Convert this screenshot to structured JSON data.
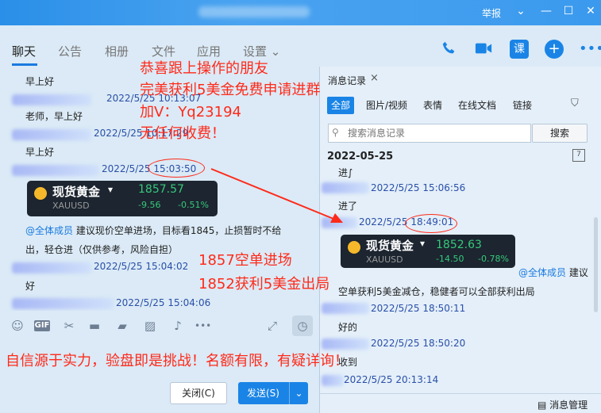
{
  "titlebar": {
    "report": "举报",
    "controls": [
      "chevron-down",
      "minimize",
      "maximize",
      "close"
    ]
  },
  "nav_tabs": [
    {
      "label": "聊天",
      "active": true
    },
    {
      "label": "公告"
    },
    {
      "label": "相册"
    },
    {
      "label": "文件"
    },
    {
      "label": "应用"
    },
    {
      "label": "设置 ⌄"
    }
  ],
  "header_icons": [
    "phone-icon",
    "video-icon",
    "class-icon",
    "plus-icon",
    "more-icon"
  ],
  "header_icon_class": "课",
  "chat": {
    "messages": [
      {
        "text": "早上好"
      },
      {
        "time": "2022/5/25 10:13:07"
      },
      {
        "text": "老师，早上好"
      },
      {
        "time": "2022/5/25 10:17:29"
      },
      {
        "text": "早上好"
      },
      {
        "time": "2022/5/25 15:03:50"
      },
      {
        "mention": "@全体成员",
        "text": "建议现价空单进场，目标看1845，止损暂时不给"
      },
      {
        "text": "出，轻仓进（仅供参考，风险自担）"
      },
      {
        "time": "2022/5/25 15:04:02"
      },
      {
        "text": "好"
      },
      {
        "time": "2022/5/25 15:04:06"
      }
    ],
    "card": {
      "name": "现货黄金",
      "caret": "▾",
      "code": "XAUUSD",
      "price": "1857.57",
      "change": "-9.56",
      "pct": "-0.51%"
    }
  },
  "toolbar_icons": [
    "emoji-icon",
    "gif-icon",
    "scissors-icon",
    "folder-icon",
    "card-icon",
    "image-icon",
    "bell-icon",
    "more-dots-icon",
    "expand-icon",
    "history-icon"
  ],
  "toolbar_gif": "GIF",
  "buttons": {
    "close": "关闭(C)",
    "send": "发送(S)",
    "send_arrow": "⌄"
  },
  "right_panel": {
    "title": "消息记录",
    "close": "×",
    "filter_tabs": [
      "全部",
      "图片/视频",
      "表情",
      "在线文档",
      "链接"
    ],
    "search_placeholder": "搜索消息记录",
    "search_button": "搜索",
    "date": "2022-05-25",
    "calendar_day": "7",
    "messages": [
      {
        "text": "进∫"
      },
      {
        "time": "2022/5/25 15:06:56"
      },
      {
        "text": "进了"
      },
      {
        "time": "2022/5/25 18:49:01"
      },
      {
        "mention": "@全体成员",
        "text": "建议"
      },
      {
        "text": "空单获利5美金减仓，稳健者可以全部获利出局"
      },
      {
        "time": "2022/5/25 18:50:11"
      },
      {
        "text": "好的"
      },
      {
        "time": "2022/5/25 18:50:20"
      },
      {
        "text": "收到"
      },
      {
        "time": "2022/5/25 20:13:14"
      }
    ],
    "card": {
      "name": "现货黄金",
      "caret": "▾",
      "code": "XAUUSD",
      "price": "1852.63",
      "change": "-14.50",
      "pct": "-0.78%"
    },
    "manage": "消息管理"
  },
  "overlays": [
    "恭喜跟上操作的朋友",
    "完美获利5美金免费申请进群",
    "加V：Yq23194",
    "无任何收费！",
    "1857空单进场",
    "1852获利5美金出局",
    "自信源于实力，验盘即是挑战！名额有限，有疑详询！"
  ],
  "colors": {
    "accent": "#1a84e6",
    "overlay_red": "#ff2a1a",
    "up_green": "#36c97a"
  }
}
